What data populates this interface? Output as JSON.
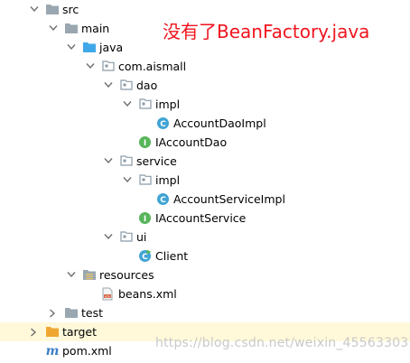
{
  "annotation": "没有了BeanFactory.java",
  "watermark": "https://blog.csdn.net/weixin_45563303",
  "colors": {
    "folder": "#9aa7b0",
    "source_folder": "#40a8e8",
    "resources_folder": "#9aa7b0",
    "excluded_folder": "#f0a732",
    "class_icon": "#41a4d4",
    "interface_icon": "#57b55a",
    "annotation_text": "#f0141e",
    "selected_row": "#fff9d9"
  },
  "tree": [
    {
      "label": "src",
      "icon": "folder-icon",
      "expanded": true
    },
    {
      "label": "main",
      "icon": "folder-icon",
      "expanded": true
    },
    {
      "label": "java",
      "icon": "source-folder-icon",
      "expanded": true
    },
    {
      "label": "com.aismall",
      "icon": "package-icon",
      "expanded": true
    },
    {
      "label": "dao",
      "icon": "package-icon",
      "expanded": true
    },
    {
      "label": "impl",
      "icon": "package-icon",
      "expanded": true
    },
    {
      "label": "AccountDaoImpl",
      "icon": "class-icon"
    },
    {
      "label": "IAccountDao",
      "icon": "interface-icon"
    },
    {
      "label": "service",
      "icon": "package-icon",
      "expanded": true
    },
    {
      "label": "impl",
      "icon": "package-icon",
      "expanded": true
    },
    {
      "label": "AccountServiceImpl",
      "icon": "class-icon"
    },
    {
      "label": "IAccountService",
      "icon": "interface-icon"
    },
    {
      "label": "ui",
      "icon": "package-icon",
      "expanded": true
    },
    {
      "label": "Client",
      "icon": "runnable-class-icon"
    },
    {
      "label": "resources",
      "icon": "resources-folder-icon",
      "expanded": true
    },
    {
      "label": "beans.xml",
      "icon": "xml-file-icon"
    },
    {
      "label": "test",
      "icon": "folder-icon",
      "expanded": false
    },
    {
      "label": "target",
      "icon": "excluded-folder-icon",
      "expanded": false
    },
    {
      "label": "pom.xml",
      "icon": "maven-icon"
    }
  ]
}
